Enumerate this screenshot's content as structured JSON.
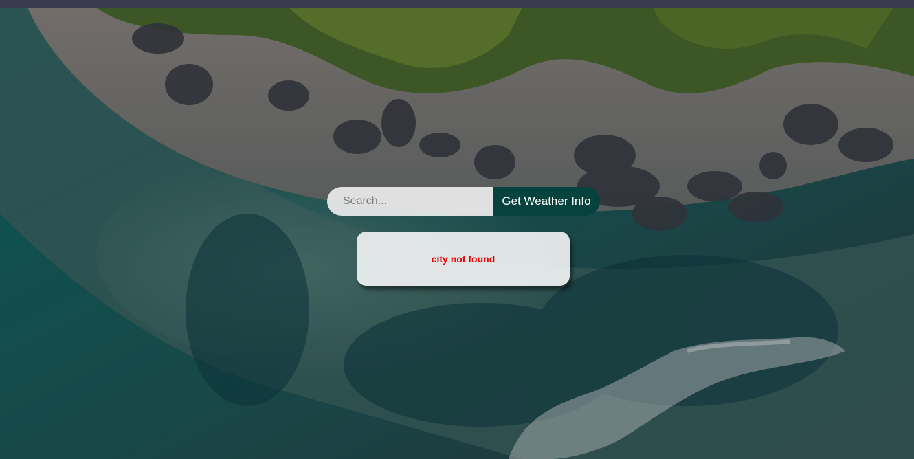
{
  "search": {
    "placeholder": "Search...",
    "value": "",
    "button_label": "Get Weather Info"
  },
  "result": {
    "error_text": "city not found"
  },
  "colors": {
    "button_bg": "#06433e",
    "error_text": "#e60000",
    "top_bar": "#3a3b4c"
  }
}
